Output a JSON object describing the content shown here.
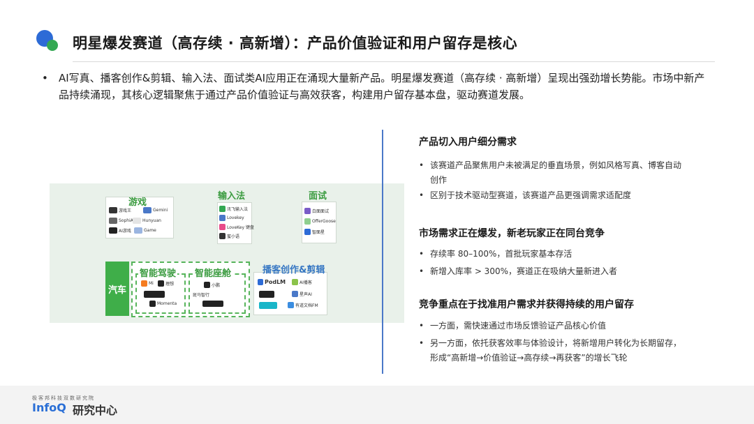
{
  "header": {
    "title": "明星爆发赛道（高存续 · 高新增）：产品价值验证和用户留存是核心"
  },
  "intro": {
    "text": "AI写真、播客创作&剪辑、输入法、面试类AI应用正在涌现大量新产品。明星爆发赛道（高存续 · 高新增）呈现出强劲增长势能。市场中新产品持续涌现，其核心逻辑聚焦于通过产品价值验证与高效获客，构建用户留存基本盘，驱动赛道发展。"
  },
  "diagram": {
    "games": {
      "label": "游戏",
      "logos": [
        "游戏王",
        "Gemini",
        "SophiA",
        "Hunyuan",
        "AI游戏",
        "Game"
      ]
    },
    "input": {
      "label": "输入法",
      "logos": [
        "讯飞输入法",
        "Lovekey",
        "LoveKey 键盘",
        "蜜小语"
      ]
    },
    "interview": {
      "label": "面试",
      "logos": [
        "白面面试",
        "OfferGoose",
        "智面星"
      ]
    },
    "auto": {
      "label": "汽车"
    },
    "smart_drive": {
      "label": "智能驾驶",
      "logos": [
        "Mi",
        "理想",
        "华为乾崑",
        "Momenta"
      ]
    },
    "smart_cabin": {
      "label": "智能座舱",
      "logos": [
        "小鹏",
        "斑马智行",
        "BYD"
      ]
    },
    "podcast": {
      "label": "播客创作&剪辑",
      "logos": [
        "PodLM",
        "AI播客",
        "声音",
        "星声AI",
        "剪映",
        "有道文档FM"
      ]
    }
  },
  "right": {
    "sections": [
      {
        "heading": "产品切入用户细分需求",
        "bullets": [
          "该赛道产品聚焦用户未被满足的垂直场景，例如风格写真、博客自动创作",
          "区别于技术驱动型赛道，该赛道产品更强调需求适配度"
        ]
      },
      {
        "heading": "市场需求正在爆发，新老玩家正在同台竞争",
        "bullets": [
          "存续率 80–100%，首批玩家基本存活",
          "新增入库率 > 300%，赛道正在吸纳大量新进入者"
        ]
      },
      {
        "heading": "竞争重点在于找准用户需求并获得持续的用户留存",
        "bullets": [
          "一方面，需快速通过市场反馈验证产品核心价值",
          "另一方面，依托获客效率与体验设计，将新增用户转化为长期留存，形成“高新增→价值验证→高存续→再获客”的增长飞轮"
        ]
      }
    ]
  },
  "footer": {
    "tagline": "极客邦科技双数研究院",
    "brand": "InfoQ",
    "brand_cn": "研究中心"
  },
  "colors": {
    "accent_blue": "#2d6bd6",
    "accent_green": "#3fae49"
  }
}
